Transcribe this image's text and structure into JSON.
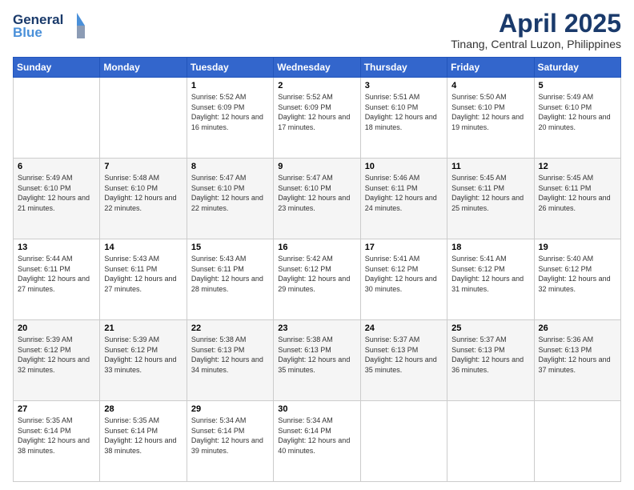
{
  "logo": {
    "line1": "General",
    "line2": "Blue",
    "tagline": "Blue"
  },
  "title": "April 2025",
  "subtitle": "Tinang, Central Luzon, Philippines",
  "days_of_week": [
    "Sunday",
    "Monday",
    "Tuesday",
    "Wednesday",
    "Thursday",
    "Friday",
    "Saturday"
  ],
  "weeks": [
    {
      "alt": false,
      "days": [
        null,
        null,
        {
          "num": "1",
          "sunrise": "Sunrise: 5:52 AM",
          "sunset": "Sunset: 6:09 PM",
          "daylight": "Daylight: 12 hours and 16 minutes."
        },
        {
          "num": "2",
          "sunrise": "Sunrise: 5:52 AM",
          "sunset": "Sunset: 6:09 PM",
          "daylight": "Daylight: 12 hours and 17 minutes."
        },
        {
          "num": "3",
          "sunrise": "Sunrise: 5:51 AM",
          "sunset": "Sunset: 6:10 PM",
          "daylight": "Daylight: 12 hours and 18 minutes."
        },
        {
          "num": "4",
          "sunrise": "Sunrise: 5:50 AM",
          "sunset": "Sunset: 6:10 PM",
          "daylight": "Daylight: 12 hours and 19 minutes."
        },
        {
          "num": "5",
          "sunrise": "Sunrise: 5:49 AM",
          "sunset": "Sunset: 6:10 PM",
          "daylight": "Daylight: 12 hours and 20 minutes."
        }
      ]
    },
    {
      "alt": true,
      "days": [
        {
          "num": "6",
          "sunrise": "Sunrise: 5:49 AM",
          "sunset": "Sunset: 6:10 PM",
          "daylight": "Daylight: 12 hours and 21 minutes."
        },
        {
          "num": "7",
          "sunrise": "Sunrise: 5:48 AM",
          "sunset": "Sunset: 6:10 PM",
          "daylight": "Daylight: 12 hours and 22 minutes."
        },
        {
          "num": "8",
          "sunrise": "Sunrise: 5:47 AM",
          "sunset": "Sunset: 6:10 PM",
          "daylight": "Daylight: 12 hours and 22 minutes."
        },
        {
          "num": "9",
          "sunrise": "Sunrise: 5:47 AM",
          "sunset": "Sunset: 6:10 PM",
          "daylight": "Daylight: 12 hours and 23 minutes."
        },
        {
          "num": "10",
          "sunrise": "Sunrise: 5:46 AM",
          "sunset": "Sunset: 6:11 PM",
          "daylight": "Daylight: 12 hours and 24 minutes."
        },
        {
          "num": "11",
          "sunrise": "Sunrise: 5:45 AM",
          "sunset": "Sunset: 6:11 PM",
          "daylight": "Daylight: 12 hours and 25 minutes."
        },
        {
          "num": "12",
          "sunrise": "Sunrise: 5:45 AM",
          "sunset": "Sunset: 6:11 PM",
          "daylight": "Daylight: 12 hours and 26 minutes."
        }
      ]
    },
    {
      "alt": false,
      "days": [
        {
          "num": "13",
          "sunrise": "Sunrise: 5:44 AM",
          "sunset": "Sunset: 6:11 PM",
          "daylight": "Daylight: 12 hours and 27 minutes."
        },
        {
          "num": "14",
          "sunrise": "Sunrise: 5:43 AM",
          "sunset": "Sunset: 6:11 PM",
          "daylight": "Daylight: 12 hours and 27 minutes."
        },
        {
          "num": "15",
          "sunrise": "Sunrise: 5:43 AM",
          "sunset": "Sunset: 6:11 PM",
          "daylight": "Daylight: 12 hours and 28 minutes."
        },
        {
          "num": "16",
          "sunrise": "Sunrise: 5:42 AM",
          "sunset": "Sunset: 6:12 PM",
          "daylight": "Daylight: 12 hours and 29 minutes."
        },
        {
          "num": "17",
          "sunrise": "Sunrise: 5:41 AM",
          "sunset": "Sunset: 6:12 PM",
          "daylight": "Daylight: 12 hours and 30 minutes."
        },
        {
          "num": "18",
          "sunrise": "Sunrise: 5:41 AM",
          "sunset": "Sunset: 6:12 PM",
          "daylight": "Daylight: 12 hours and 31 minutes."
        },
        {
          "num": "19",
          "sunrise": "Sunrise: 5:40 AM",
          "sunset": "Sunset: 6:12 PM",
          "daylight": "Daylight: 12 hours and 32 minutes."
        }
      ]
    },
    {
      "alt": true,
      "days": [
        {
          "num": "20",
          "sunrise": "Sunrise: 5:39 AM",
          "sunset": "Sunset: 6:12 PM",
          "daylight": "Daylight: 12 hours and 32 minutes."
        },
        {
          "num": "21",
          "sunrise": "Sunrise: 5:39 AM",
          "sunset": "Sunset: 6:12 PM",
          "daylight": "Daylight: 12 hours and 33 minutes."
        },
        {
          "num": "22",
          "sunrise": "Sunrise: 5:38 AM",
          "sunset": "Sunset: 6:13 PM",
          "daylight": "Daylight: 12 hours and 34 minutes."
        },
        {
          "num": "23",
          "sunrise": "Sunrise: 5:38 AM",
          "sunset": "Sunset: 6:13 PM",
          "daylight": "Daylight: 12 hours and 35 minutes."
        },
        {
          "num": "24",
          "sunrise": "Sunrise: 5:37 AM",
          "sunset": "Sunset: 6:13 PM",
          "daylight": "Daylight: 12 hours and 35 minutes."
        },
        {
          "num": "25",
          "sunrise": "Sunrise: 5:37 AM",
          "sunset": "Sunset: 6:13 PM",
          "daylight": "Daylight: 12 hours and 36 minutes."
        },
        {
          "num": "26",
          "sunrise": "Sunrise: 5:36 AM",
          "sunset": "Sunset: 6:13 PM",
          "daylight": "Daylight: 12 hours and 37 minutes."
        }
      ]
    },
    {
      "alt": false,
      "days": [
        {
          "num": "27",
          "sunrise": "Sunrise: 5:35 AM",
          "sunset": "Sunset: 6:14 PM",
          "daylight": "Daylight: 12 hours and 38 minutes."
        },
        {
          "num": "28",
          "sunrise": "Sunrise: 5:35 AM",
          "sunset": "Sunset: 6:14 PM",
          "daylight": "Daylight: 12 hours and 38 minutes."
        },
        {
          "num": "29",
          "sunrise": "Sunrise: 5:34 AM",
          "sunset": "Sunset: 6:14 PM",
          "daylight": "Daylight: 12 hours and 39 minutes."
        },
        {
          "num": "30",
          "sunrise": "Sunrise: 5:34 AM",
          "sunset": "Sunset: 6:14 PM",
          "daylight": "Daylight: 12 hours and 40 minutes."
        },
        null,
        null,
        null
      ]
    }
  ]
}
